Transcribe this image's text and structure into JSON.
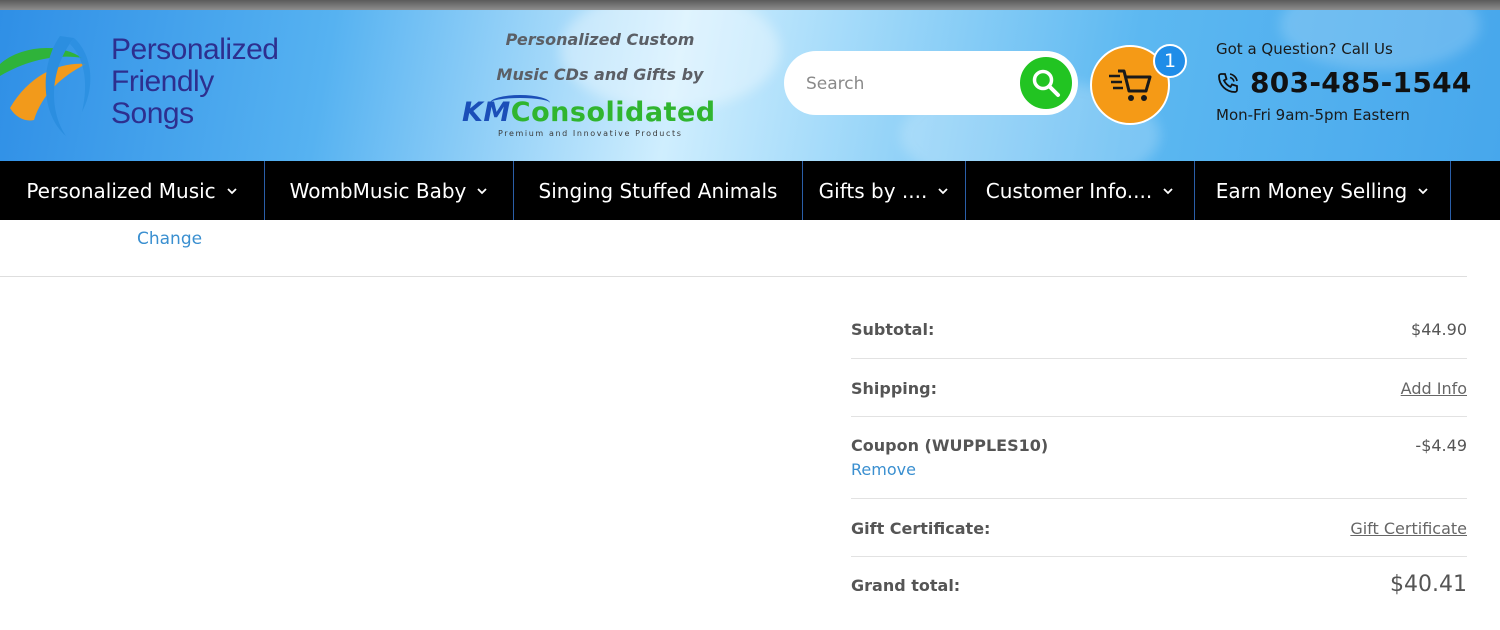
{
  "header": {
    "logo_line1": "Personalized",
    "logo_line2": "Friendly",
    "logo_line3": "Songs",
    "tagline_line1": "Personalized Custom",
    "tagline_line2": "Music CDs and Gifts by",
    "partner_km": "KM",
    "partner_rest": "Consolidated",
    "partner_sub": "Premium and Innovative Products",
    "search_placeholder": "Search",
    "cart_count": "1",
    "contact_question": "Got a Question? Call Us",
    "contact_phone": "803-485-1544",
    "contact_hours": "Mon-Fri 9am-5pm Eastern",
    "colors": {
      "search_button": "#22c422",
      "cart": "#f59a16",
      "badge": "#1f8de8"
    }
  },
  "nav": {
    "items": [
      {
        "label": "Personalized Music",
        "has_dropdown": true
      },
      {
        "label": "WombMusic Baby",
        "has_dropdown": true
      },
      {
        "label": "Singing Stuffed Animals",
        "has_dropdown": false
      },
      {
        "label": "Gifts by ....",
        "has_dropdown": true
      },
      {
        "label": "Customer Info....",
        "has_dropdown": true
      },
      {
        "label": "Earn Money Selling",
        "has_dropdown": true
      }
    ]
  },
  "main": {
    "change_link": "Change"
  },
  "summary": {
    "subtotal_label": "Subtotal:",
    "subtotal_value": "$44.90",
    "shipping_label": "Shipping:",
    "shipping_link": "Add Info",
    "coupon_label": "Coupon (WUPPLES10)",
    "coupon_value": "-$4.49",
    "coupon_remove": "Remove",
    "gift_label": "Gift Certificate:",
    "gift_link": "Gift Certificate",
    "grand_label": "Grand total:",
    "grand_value": "$40.41"
  },
  "icons": [
    "logo-swirl-icon",
    "search-icon",
    "cart-icon",
    "phone-icon",
    "chevron-down-icon"
  ]
}
